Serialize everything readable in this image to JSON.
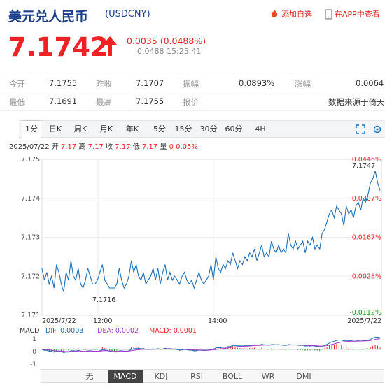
{
  "header": {
    "title": "美元兑人民币",
    "code": "(USDCNY)",
    "add_watch": "添加自选",
    "open_app": "在APP中查看"
  },
  "quote": {
    "price": "7.1742",
    "change": "0.0035 (0.0488%)",
    "sub": "0.0488 15:25:41"
  },
  "stats": {
    "row1": [
      {
        "label": "今开",
        "value": "7.1755"
      },
      {
        "label": "昨收",
        "value": "7.1707"
      },
      {
        "label": "振幅",
        "value": "0.0893%"
      },
      {
        "label": "涨幅",
        "value": "0.0064"
      }
    ],
    "row2": [
      {
        "label": "最低",
        "value": "7.1691"
      },
      {
        "label": "最高",
        "value": "7.1755"
      },
      {
        "label": "报价",
        "value": ""
      }
    ],
    "source": "数据来源于倚天"
  },
  "tabs": [
    "1分",
    "日K",
    "周K",
    "月K",
    "年K",
    "5分",
    "15分",
    "30分",
    "60分",
    "4H"
  ],
  "info_line": {
    "date": "2025/07/22",
    "open_label": "开",
    "open": "7.17",
    "high_label": "高",
    "high": "7.17",
    "close_label": "收",
    "close": "7.17",
    "low_label": "低",
    "low": "7.17",
    "vol_label": "量",
    "vol": "0",
    "pct": "0.05%"
  },
  "chart_data": {
    "type": "line",
    "y_ticks": [
      "7.175",
      "7.174",
      "7.173",
      "7.172",
      "7.171"
    ],
    "pct_ticks": [
      "0.0446%",
      "0.0307%",
      "0.0167%",
      "0.0028%",
      "-0.0112%"
    ],
    "x_ticks": [
      "2025/7/22",
      "12:00",
      "14:00",
      "2025/7/22"
    ],
    "ylim": [
      7.171,
      7.175
    ],
    "max_label": "7.1747",
    "min_label": "7.1716",
    "values": [
      7.1722,
      7.1719,
      7.1721,
      7.1718,
      7.172,
      7.1717,
      7.1723,
      7.1721,
      7.1718,
      7.1716,
      7.1721,
      7.1719,
      7.1724,
      7.172,
      7.1719,
      7.1722,
      7.1718,
      7.1717,
      7.1719,
      7.1722,
      7.172,
      7.1718,
      7.1718,
      7.1719,
      7.1721,
      7.1723,
      7.1719,
      7.1718,
      7.1717,
      7.1717,
      7.1717,
      7.1718,
      7.1722,
      7.1719,
      7.1717,
      7.1718,
      7.172,
      7.1724,
      7.1721,
      7.1723,
      7.172,
      7.1719,
      7.1721,
      7.1718,
      7.1719,
      7.172,
      7.1722,
      7.1719,
      7.1722,
      7.1718,
      7.1721,
      7.1723,
      7.1719,
      7.1721,
      7.1719,
      7.172,
      7.1719,
      7.1718,
      7.172,
      7.1721,
      7.1719,
      7.1718,
      7.1719,
      7.1717,
      7.1719,
      7.1721,
      7.1719,
      7.1718,
      7.1719,
      7.172,
      7.1723,
      7.1719,
      7.1725,
      7.1722,
      7.1721,
      7.1723,
      7.1722,
      7.1724,
      7.1723,
      7.1726,
      7.1724,
      7.1722,
      7.1724,
      7.1723,
      7.1725,
      7.1724,
      7.1726,
      7.1725,
      7.1727,
      7.1724,
      7.1726,
      7.1728,
      7.1725,
      7.1726,
      7.1725,
      7.1729,
      7.1727,
      7.1726,
      7.1728,
      7.1726,
      7.1727,
      7.1726,
      7.1731,
      7.1728,
      7.1727,
      7.1729,
      7.1727,
      7.1728,
      7.1729,
      7.1726,
      7.1729,
      7.1728,
      7.173,
      7.1727,
      7.1728,
      7.1727,
      7.1731,
      7.1732,
      7.1734,
      7.1736,
      7.1737,
      7.1735,
      7.1738,
      7.1737,
      7.1736,
      7.1733,
      7.1738,
      7.1736,
      7.1737,
      7.1735,
      7.1738,
      7.1739,
      7.1737,
      7.174,
      7.1739,
      7.1741,
      7.1744,
      7.1745,
      7.1747,
      7.1744,
      7.1742
    ],
    "indicator": {
      "name": "MACD",
      "dif_label": "DIF: 0.0003",
      "dea_label": "DEA: 0.0002",
      "macd_label": "MACD: 0.0001",
      "y_ticks": [
        "1",
        "0",
        "-1"
      ]
    }
  },
  "indicator_tabs": [
    "无",
    "MACD",
    "KDJ",
    "RSI",
    "BOLL",
    "WR",
    "DMI"
  ],
  "colors": {
    "line": "#1f6fb5",
    "up": "#e22",
    "down": "#1a9a1a",
    "dif": "#1f6fb5",
    "dea": "#a238c8"
  }
}
